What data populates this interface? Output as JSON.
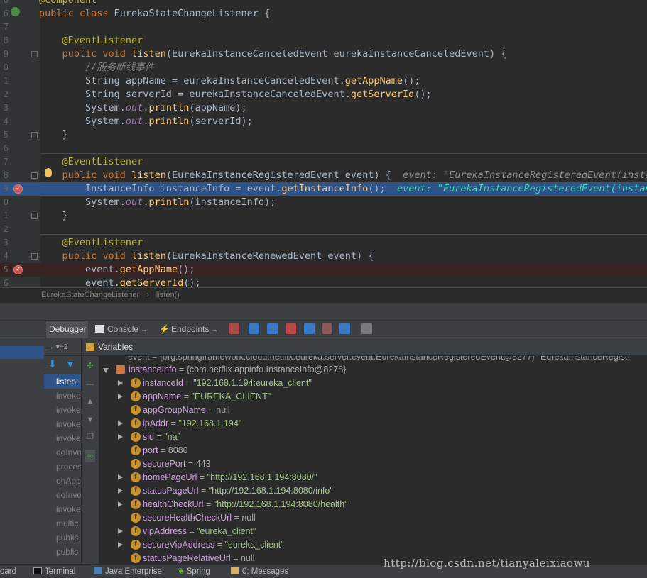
{
  "editor": {
    "lines": [
      {
        "num": "6",
        "tokens": [
          [
            "an",
            "@Component"
          ]
        ]
      },
      {
        "num": "6",
        "tokens": [
          [
            "k",
            "public class "
          ],
          [
            "",
            "EurekaStateChangeListener {"
          ]
        ]
      },
      {
        "num": "7",
        "tokens": []
      },
      {
        "num": "8",
        "tokens": [
          [
            "",
            "    "
          ],
          [
            "an",
            "@EventListener"
          ]
        ]
      },
      {
        "num": "9",
        "tokens": [
          [
            "",
            "    "
          ],
          [
            "k",
            "public void "
          ],
          [
            "fn",
            "listen"
          ],
          [
            "",
            "(EurekaInstanceCanceledEvent eurekaInstanceCanceledEvent) {"
          ]
        ]
      },
      {
        "num": "0",
        "tokens": [
          [
            "",
            "        "
          ],
          [
            "cm",
            "//服务断线事件"
          ]
        ]
      },
      {
        "num": "1",
        "tokens": [
          [
            "",
            "        String appName = eurekaInstanceCanceledEvent."
          ],
          [
            "fn",
            "getAppName"
          ],
          [
            "",
            "();"
          ]
        ]
      },
      {
        "num": "2",
        "tokens": [
          [
            "",
            "        String serverId = eurekaInstanceCanceledEvent."
          ],
          [
            "fn",
            "getServerId"
          ],
          [
            "",
            "();"
          ]
        ]
      },
      {
        "num": "3",
        "tokens": [
          [
            "",
            "        System."
          ],
          [
            "st",
            "out"
          ],
          [
            "",
            "."
          ],
          [
            "fn",
            "println"
          ],
          [
            "",
            "(appName);"
          ]
        ]
      },
      {
        "num": "4",
        "tokens": [
          [
            "",
            "        System."
          ],
          [
            "st",
            "out"
          ],
          [
            "",
            "."
          ],
          [
            "fn",
            "println"
          ],
          [
            "",
            "(serverId);"
          ]
        ]
      },
      {
        "num": "5",
        "tokens": [
          [
            "",
            "    }"
          ]
        ]
      },
      {
        "num": "6",
        "tokens": []
      },
      {
        "num": "7",
        "tokens": [
          [
            "",
            "    "
          ],
          [
            "an",
            "@EventListener"
          ]
        ]
      },
      {
        "num": "8",
        "tokens": [
          [
            "",
            "    "
          ],
          [
            "k",
            "public void "
          ],
          [
            "fn",
            "listen"
          ],
          [
            "",
            "(EurekaInstanceRegisteredEvent event) {  "
          ],
          [
            "hint",
            "event: \"EurekaInstanceRegisteredEvent(instanc"
          ]
        ]
      },
      {
        "num": "9",
        "tokens": [
          [
            "",
            "        InstanceInfo instanceInfo = event."
          ],
          [
            "fn",
            "getInstanceInfo"
          ],
          [
            "",
            "();  "
          ],
          [
            "hint2",
            "event: \"EurekaInstanceRegisteredEvent(instanc"
          ]
        ]
      },
      {
        "num": "0",
        "tokens": [
          [
            "",
            "        System."
          ],
          [
            "st",
            "out"
          ],
          [
            "",
            "."
          ],
          [
            "fn",
            "println"
          ],
          [
            "",
            "(instanceInfo);"
          ]
        ]
      },
      {
        "num": "1",
        "tokens": [
          [
            "",
            "    }"
          ]
        ]
      },
      {
        "num": "2",
        "tokens": []
      },
      {
        "num": "3",
        "tokens": [
          [
            "",
            "    "
          ],
          [
            "an",
            "@EventListener"
          ]
        ]
      },
      {
        "num": "4",
        "tokens": [
          [
            "",
            "    "
          ],
          [
            "k",
            "public void "
          ],
          [
            "fn",
            "listen"
          ],
          [
            "",
            "(EurekaInstanceRenewedEvent event) {"
          ]
        ]
      },
      {
        "num": "5",
        "tokens": [
          [
            "",
            "        event."
          ],
          [
            "fn",
            "getAppName"
          ],
          [
            "",
            "();"
          ]
        ]
      },
      {
        "num": "6",
        "tokens": [
          [
            "",
            "        event."
          ],
          [
            "fn",
            "getServerId"
          ],
          [
            "",
            "();"
          ]
        ]
      }
    ]
  },
  "breadcrumb": {
    "class_name": "EurekaStateChangeListener",
    "method": "listen()",
    "sep": "›"
  },
  "debug_tabs": {
    "debugger": "Debugger",
    "console": "Console",
    "endpoints": "Endpoints"
  },
  "frames": {
    "thread_count": "2",
    "items": [
      "listen:",
      "invoke",
      "invoke",
      "invoke",
      "invoke",
      "doInvo",
      "proces",
      "onApp",
      "doInvo",
      "invoke",
      "multic",
      "publis",
      "publis"
    ]
  },
  "variables": {
    "title": "Variables",
    "top_clip": "event = {org.springframework.cloud.netflix.eureka.server.event.EurekaInstanceRegisteredEvent@8277} \"EurekaInstanceRegist",
    "root": {
      "name": "instanceInfo",
      "value": "{com.netflix.appinfo.InstanceInfo@8278}"
    },
    "fields": [
      {
        "name": "instanceId",
        "value": "\"192.168.1.194:eureka_client\"",
        "kind": "str",
        "exp": true
      },
      {
        "name": "appName",
        "value": "\"EUREKA_CLIENT\"",
        "kind": "str",
        "exp": true
      },
      {
        "name": "appGroupName",
        "value": "null",
        "kind": "plain",
        "exp": false
      },
      {
        "name": "ipAddr",
        "value": "\"192.168.1.194\"",
        "kind": "str",
        "exp": true
      },
      {
        "name": "sid",
        "value": "\"na\"",
        "kind": "str",
        "exp": true
      },
      {
        "name": "port",
        "value": "8080",
        "kind": "plain",
        "exp": false
      },
      {
        "name": "securePort",
        "value": "443",
        "kind": "plain",
        "exp": false
      },
      {
        "name": "homePageUrl",
        "value": "\"http://192.168.1.194:8080/\"",
        "kind": "str",
        "exp": true
      },
      {
        "name": "statusPageUrl",
        "value": "\"http://192.168.1.194:8080/info\"",
        "kind": "str",
        "exp": true
      },
      {
        "name": "healthCheckUrl",
        "value": "\"http://192.168.1.194:8080/health\"",
        "kind": "str",
        "exp": true
      },
      {
        "name": "secureHealthCheckUrl",
        "value": "null",
        "kind": "plain",
        "exp": false
      },
      {
        "name": "vipAddress",
        "value": "\"eureka_client\"",
        "kind": "str",
        "exp": true
      },
      {
        "name": "secureVipAddress",
        "value": "\"eureka_client\"",
        "kind": "str",
        "exp": true
      },
      {
        "name": "statusPageRelativeUrl",
        "value": "null",
        "kind": "plain",
        "exp": false
      }
    ]
  },
  "statusbar": {
    "board": "oard",
    "terminal": "Terminal",
    "java_enterprise": "Java Enterprise",
    "spring": "Spring",
    "messages": "0: Messages"
  },
  "watermark": "http://blog.csdn.net/tianyaleixiaowu"
}
